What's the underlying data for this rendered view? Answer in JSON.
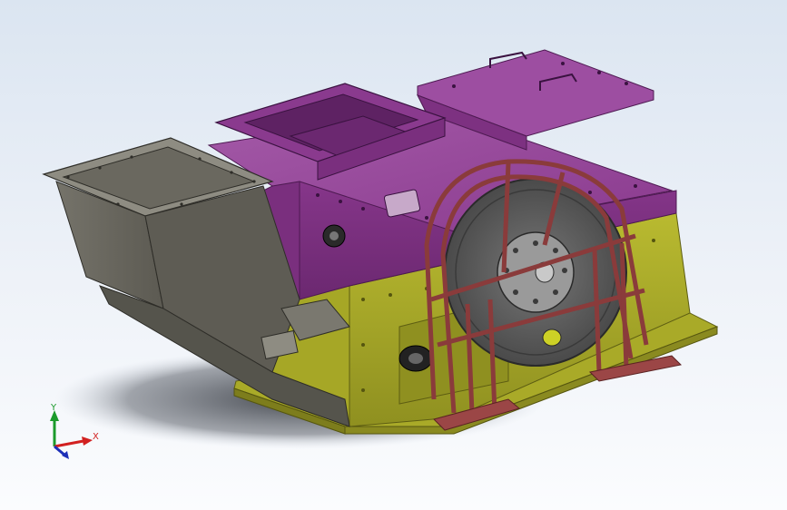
{
  "viewport": {
    "background_top": "#dbe5f1",
    "background_bottom": "#fbfcfe"
  },
  "model": {
    "colors": {
      "housing_purple": "#8a3a8e",
      "housing_purple_light": "#a557a8",
      "housing_purple_dark": "#5e2263",
      "base_yellow": "#b2b32a",
      "base_yellow_dark": "#7d7d1c",
      "hopper_gray": "#6f6d63",
      "hopper_gray_light": "#8e8c82",
      "guard_red": "#8a3b3b",
      "wheel_gray": "#5d5d5d",
      "hub_gray": "#9a9a9a",
      "shadow": "#4b4f56"
    },
    "icons": [
      "flywheel-icon",
      "hopper-icon",
      "housing-icon",
      "base-frame-icon",
      "belt-guard-icon"
    ]
  },
  "triad": {
    "x_label": "X",
    "y_label": "Y",
    "x_color": "#d22020",
    "y_color": "#1b9a2b",
    "z_color": "#1c2fb8"
  }
}
